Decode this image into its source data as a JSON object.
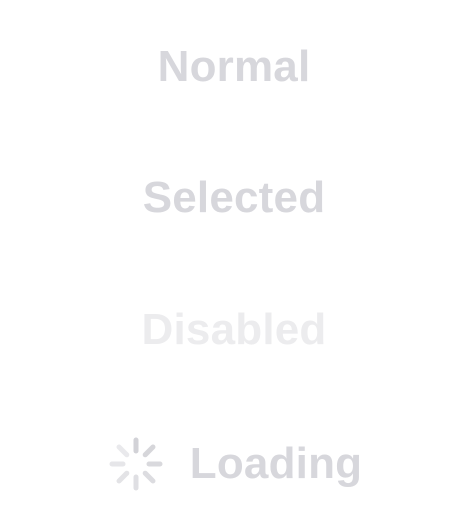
{
  "buttons": {
    "normal_label": "Normal",
    "selected_label": "Selected",
    "disabled_label": "Disabled",
    "loading_label": "Loading"
  },
  "spinner": {
    "icon": "activity-indicator-icon",
    "color": "#d2d2d7"
  },
  "colors": {
    "label": "#d7d7dc",
    "disabled_label": "#ececee",
    "background": "#ffffff"
  }
}
